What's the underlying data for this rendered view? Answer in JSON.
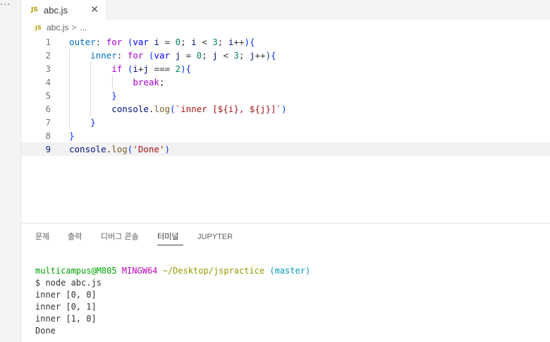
{
  "window": {
    "more_glyph": "···"
  },
  "tab": {
    "icon_text": "JS",
    "label": "abc.js",
    "close_glyph": "✕"
  },
  "breadcrumb": {
    "icon_text": "JS",
    "file": "abc.js",
    "separator": ">",
    "trail": "..."
  },
  "editor": {
    "current_line": 9,
    "lines": [
      {
        "num": "1",
        "text": "outer: for (var i = 0; i < 3; i++){"
      },
      {
        "num": "2",
        "text": "    inner: for (var j = 0; j < 3; j++){"
      },
      {
        "num": "3",
        "text": "        if (i+j === 2){"
      },
      {
        "num": "4",
        "text": "            break;"
      },
      {
        "num": "5",
        "text": "        }"
      },
      {
        "num": "6",
        "text": "        console.log(`inner [${i}, ${j}]`)"
      },
      {
        "num": "7",
        "text": "    }"
      },
      {
        "num": "8",
        "text": "}"
      },
      {
        "num": "9",
        "text": "console.log('Done')"
      }
    ]
  },
  "panel": {
    "tabs": [
      "문제",
      "출력",
      "디버그 콘솔",
      "터미널",
      "JUPYTER"
    ],
    "active_tab": "터미널",
    "terminal": {
      "prompt": {
        "user_host": "multicampus@M805",
        "env": "MINGW64",
        "path": "~/Desktop/jspractice",
        "branch": "(master)"
      },
      "command": "$ node abc.js",
      "output": [
        "inner [0, 0]",
        "inner [0, 1]",
        "inner [1, 0]",
        "Done"
      ]
    }
  },
  "colors": {
    "keyword": "#af00db",
    "declaration": "#0000ff",
    "variable": "#001080",
    "number": "#098658",
    "string": "#a31515",
    "function": "#795e26",
    "label": "#0070c1",
    "terminal_user": "#00a000",
    "terminal_env": "#bc05bc",
    "terminal_path": "#949800",
    "terminal_branch": "#0598bc"
  }
}
